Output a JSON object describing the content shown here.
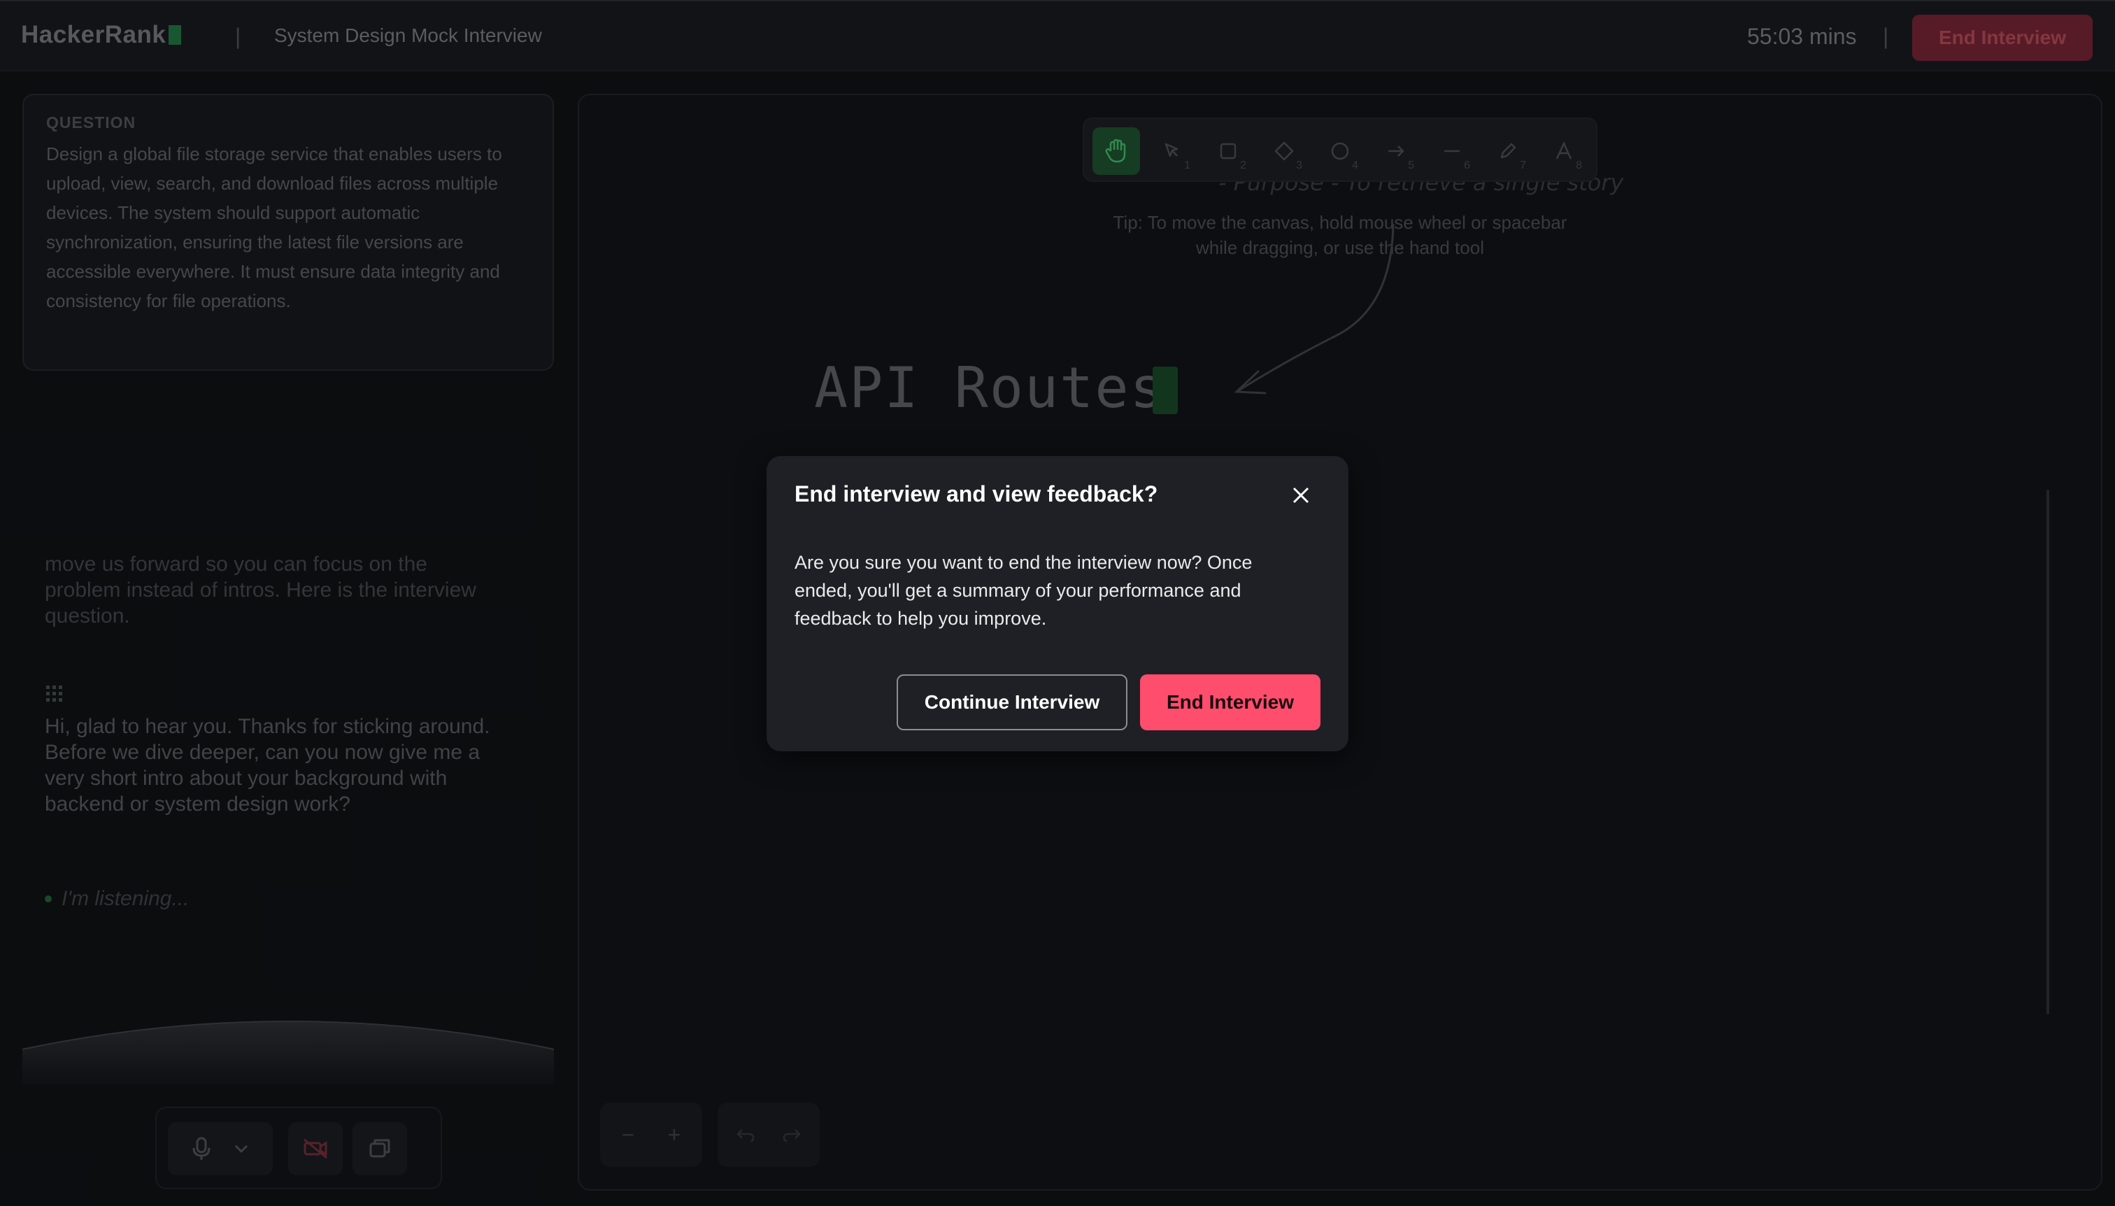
{
  "header": {
    "logo": "HackerRank",
    "separator": "|",
    "title": "System Design Mock Interview",
    "timer": "55:03 mins",
    "end_button_label": "End Interview"
  },
  "question": {
    "label": "QUESTION",
    "text": "Design a global file storage service that enables users to upload, view, search, and download files across multiple devices. The system should support automatic synchronization, ensuring the latest file versions are accessible everywhere. It must ensure data integrity and consistency for file operations."
  },
  "chat": {
    "faded_message": "move us forward so you can focus on the problem instead of intros. Here is the interview question.",
    "message": "Hi, glad to hear you. Thanks for sticking around. Before we dive deeper, can you now give me a very short intro about your background with backend or system design work?",
    "listening": "I'm listening..."
  },
  "canvas": {
    "faded_note": "- Purpose - To retrieve a single story",
    "tip": "Tip: To move the canvas, hold mouse wheel or spacebar while dragging, or use the hand tool",
    "heading": "API Routes",
    "tools": [
      {
        "icon": "hand-icon",
        "shortcut": ""
      },
      {
        "icon": "pointer-icon",
        "shortcut": "1"
      },
      {
        "icon": "rectangle-icon",
        "shortcut": "2"
      },
      {
        "icon": "diamond-icon",
        "shortcut": "3"
      },
      {
        "icon": "ellipse-icon",
        "shortcut": "4"
      },
      {
        "icon": "arrow-icon",
        "shortcut": "5"
      },
      {
        "icon": "line-icon",
        "shortcut": "6"
      },
      {
        "icon": "pencil-icon",
        "shortcut": "7"
      },
      {
        "icon": "text-icon",
        "shortcut": "8"
      }
    ],
    "zoom_out": "−",
    "zoom_in": "+"
  },
  "modal": {
    "title": "End interview and view feedback?",
    "body": "Are you sure you want to end the interview now? Once ended, you'll get a summary of your performance and feedback to help you improve.",
    "continue_label": "Continue Interview",
    "end_label": "End Interview"
  },
  "colors": {
    "accent_red": "#ff4d6d",
    "active_green": "#1b4a2b",
    "modal_bg": "#1f2026"
  }
}
